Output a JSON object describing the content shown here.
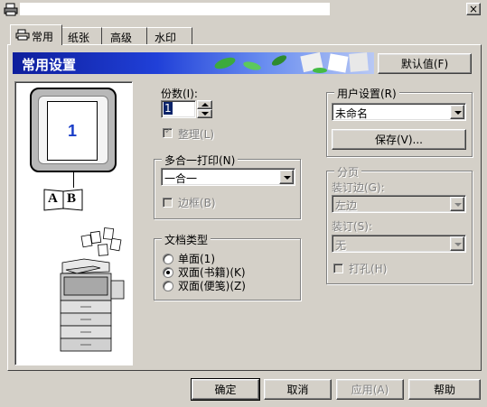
{
  "window": {
    "close_label": "×"
  },
  "tabs": [
    {
      "label": "常用"
    },
    {
      "label": "纸张"
    },
    {
      "label": "高级"
    },
    {
      "label": "水印"
    }
  ],
  "banner": {
    "title": "常用设置",
    "defaults_button": "默认值(F)"
  },
  "preview": {
    "page_number": "1",
    "book_letters": [
      "A",
      "B"
    ]
  },
  "copies": {
    "label": "份数(I):",
    "value": "1",
    "collate_label": "整理(L)"
  },
  "nup": {
    "group_label": "多合一打印(N)",
    "selected": "一合一",
    "border_label": "边框(B)"
  },
  "doctype": {
    "group_label": "文档类型",
    "options": [
      {
        "label": "单面(1)",
        "checked": false
      },
      {
        "label": "双面(书籍)(K)",
        "checked": true
      },
      {
        "label": "双面(便笺)(Z)",
        "checked": false
      }
    ]
  },
  "user_settings": {
    "group_label": "用户设置(R)",
    "selected": "未命名",
    "save_button": "保存(V)..."
  },
  "sorting": {
    "group_label": "分页",
    "binding_edge_label": "装订边(G):",
    "binding_edge_value": "左边",
    "staple_label": "装订(S):",
    "staple_value": "无",
    "punch_label": "打孔(H)"
  },
  "footer": {
    "ok": "确定",
    "cancel": "取消",
    "apply": "应用(A)",
    "help": "帮助"
  }
}
